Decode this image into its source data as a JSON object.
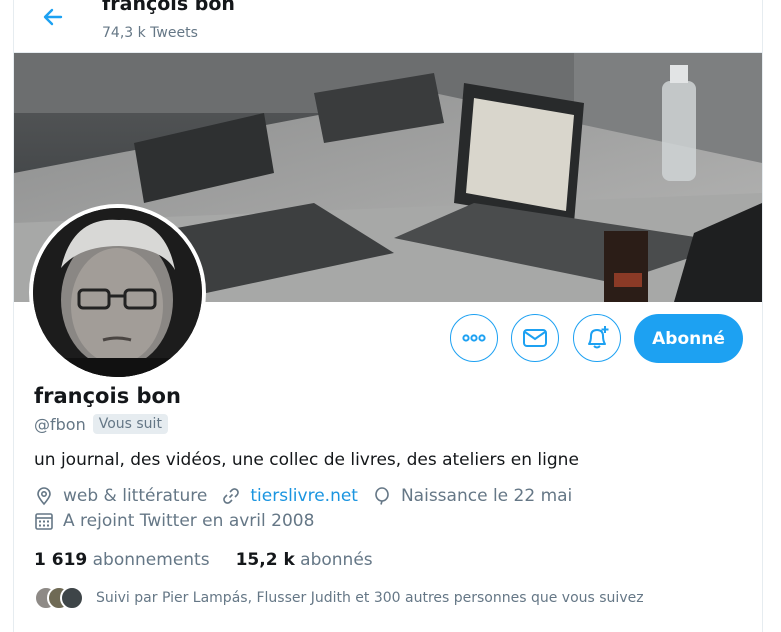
{
  "header": {
    "title": "françois bon",
    "tweet_count": "74,3 k Tweets"
  },
  "profile": {
    "name": "françois bon",
    "handle": "@fbon",
    "follows_you": "Vous suit",
    "bio": "un journal, des vidéos, une collec de livres, des ateliers en ligne",
    "location": "web & littérature",
    "website": "tierslivre.net",
    "birthday": "Naissance le 22 mai",
    "joined": "A rejoint Twitter en avril 2008",
    "following_count": "1 619",
    "following_label": "abonnements",
    "followers_count": "15,2 k",
    "followers_label": "abonnés",
    "followed_by": "Suivi par Pier Lampás, Flusser Judith et 300 autres personnes que vous suivez"
  },
  "actions": {
    "more": "more-icon",
    "message": "mail-icon",
    "notify": "bell-plus-icon",
    "follow_label": "Abonné"
  },
  "colors": {
    "accent": "#1da1f2",
    "link": "#1b95e0",
    "secondary_text": "#657786",
    "primary_text": "#14171a"
  }
}
